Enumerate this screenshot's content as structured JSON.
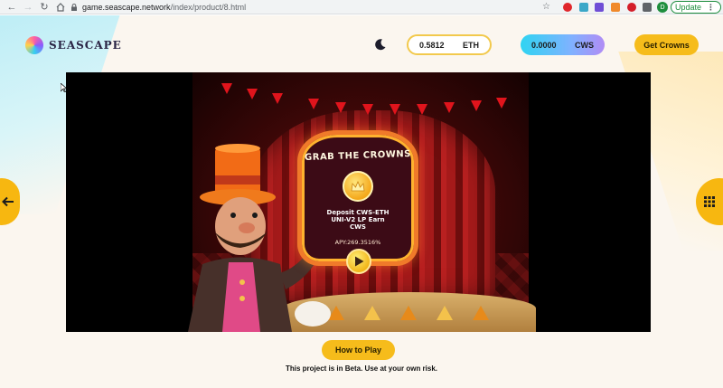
{
  "browser": {
    "url_host": "game.seascape.network",
    "url_path": "/index/product/8.html",
    "profile_initial": "D",
    "update_label": "Update"
  },
  "header": {
    "logo_text": "SEASCAPE",
    "eth_balance": "0.5812",
    "eth_unit": "ETH",
    "cws_balance": "0.0000",
    "cws_unit": "CWS",
    "get_crowns_label": "Get Crowns"
  },
  "game": {
    "sign_title": "GRAB THE CROWNS",
    "sign_lines": [
      "Deposit CWS-ETH",
      "UNI-V2 LP Earn",
      "CWS"
    ],
    "apy": "APY:269.3516%"
  },
  "footer": {
    "how_to_play_label": "How to Play",
    "beta_notice": "This project is in Beta. Use at your own risk."
  },
  "colors": {
    "accent_yellow": "#f6bc1b",
    "eth_border": "#f2c94c",
    "cws_gradient_start": "#2fd4f2",
    "cws_gradient_end": "#b18cf5"
  },
  "icons": [
    "back-arrow-icon",
    "forward-arrow-icon",
    "reload-icon",
    "home-icon",
    "lock-icon",
    "star-icon",
    "moon-icon",
    "left-arrow-icon",
    "grid-icon",
    "crown-icon",
    "play-icon"
  ]
}
